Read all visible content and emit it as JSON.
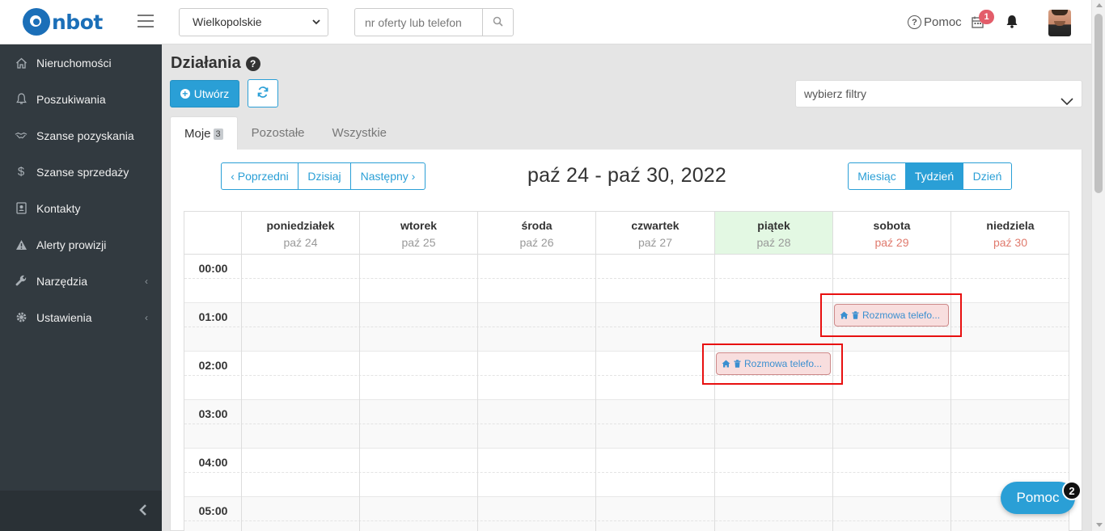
{
  "app": {
    "logo_text": "nbot",
    "brand_color": "#1b6fb8",
    "accent_color": "#2a9fd6"
  },
  "header": {
    "region_value": "Wielkopolskie",
    "search_placeholder": "nr oferty lub telefon",
    "help_label": "Pomoc",
    "calendar_badge": "1",
    "icons": {
      "menu": "hamburger-icon",
      "search": "search-icon",
      "help": "question-circle-icon",
      "calendar": "calendar-icon",
      "notifications": "bell-icon"
    }
  },
  "sidebar": {
    "items": [
      {
        "label": "Nieruchomości",
        "icon": "home-icon",
        "has_submenu": false
      },
      {
        "label": "Poszukiwania",
        "icon": "bell-icon",
        "has_submenu": false
      },
      {
        "label": "Szanse pozyskania",
        "icon": "handshake-icon",
        "has_submenu": false
      },
      {
        "label": "Szanse sprzedaży",
        "icon": "dollar-icon",
        "has_submenu": false
      },
      {
        "label": "Kontakty",
        "icon": "address-book-icon",
        "has_submenu": false
      },
      {
        "label": "Alerty prowizji",
        "icon": "warning-icon",
        "has_submenu": false
      },
      {
        "label": "Narzędzia",
        "icon": "wrench-icon",
        "has_submenu": true
      },
      {
        "label": "Ustawienia",
        "icon": "gear-icon",
        "has_submenu": true
      }
    ],
    "chevron": "‹",
    "collapse_icon": "chevron-left-icon"
  },
  "page": {
    "title": "Działania",
    "title_help": "?",
    "create_label": "Utwórz",
    "filter_placeholder": "wybierz filtry",
    "tabs": [
      {
        "label": "Moje",
        "count": "3",
        "active": true
      },
      {
        "label": "Pozostałe",
        "active": false
      },
      {
        "label": "Wszystkie",
        "active": false
      }
    ]
  },
  "calendar": {
    "nav": {
      "prev": "‹ Poprzedni",
      "today": "Dzisiaj",
      "next": "Następny ›"
    },
    "range_title": "paź 24 - paź 30, 2022",
    "views": [
      {
        "label": "Miesiąc",
        "active": false
      },
      {
        "label": "Tydzień",
        "active": true
      },
      {
        "label": "Dzień",
        "active": false
      }
    ],
    "days": [
      {
        "name": "poniedziałek",
        "date": "paź 24",
        "today": false,
        "weekend": false
      },
      {
        "name": "wtorek",
        "date": "paź 25",
        "today": false,
        "weekend": false
      },
      {
        "name": "środa",
        "date": "paź 26",
        "today": false,
        "weekend": false
      },
      {
        "name": "czwartek",
        "date": "paź 27",
        "today": false,
        "weekend": false
      },
      {
        "name": "piątek",
        "date": "paź 28",
        "today": true,
        "weekend": false
      },
      {
        "name": "sobota",
        "date": "paź 29",
        "today": false,
        "weekend": true
      },
      {
        "name": "niedziela",
        "date": "paź 30",
        "today": false,
        "weekend": true
      }
    ],
    "hours": [
      "00:00",
      "01:00",
      "02:00",
      "03:00",
      "04:00",
      "05:00"
    ],
    "events": [
      {
        "title": "Rozmowa telefo...",
        "day": "sobota",
        "time": "01:00",
        "highlighted": true
      },
      {
        "title": "Rozmowa telefo...",
        "day": "piątek",
        "time": "02:00",
        "highlighted": true
      }
    ]
  },
  "help_widget": {
    "label": "Pomoc",
    "badge": "2"
  }
}
